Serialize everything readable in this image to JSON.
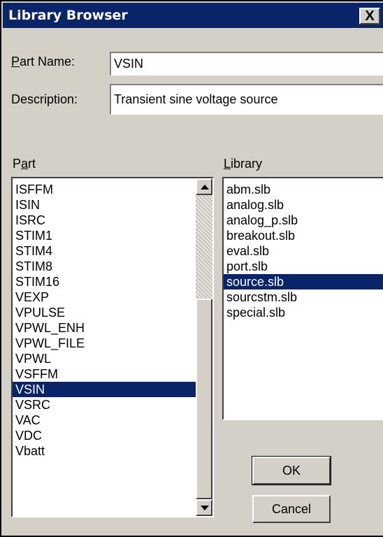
{
  "window": {
    "title": "Library Browser",
    "close_glyph": "X"
  },
  "part_name": {
    "label_accel": "P",
    "label_rest": "art Name:",
    "value": "VSIN"
  },
  "description": {
    "label": "Description:",
    "value": "Transient sine voltage source"
  },
  "part_list": {
    "label_pre": "P",
    "label_accel": "a",
    "label_post": "rt",
    "items": [
      "ISFFM",
      "ISIN",
      "ISRC",
      "STIM1",
      "STIM4",
      "STIM8",
      "STIM16",
      "VEXP",
      "VPULSE",
      "VPWL_ENH",
      "VPWL_FILE",
      "VPWL",
      "VSFFM",
      "VSIN",
      "VSRC",
      "VAC",
      "VDC",
      "Vbatt"
    ],
    "selected": "VSIN"
  },
  "library_list": {
    "label_accel": "L",
    "label_rest": "ibrary",
    "items": [
      "abm.slb",
      "analog.slb",
      "analog_p.slb",
      "breakout.slb",
      "eval.slb",
      "port.slb",
      "source.slb",
      "sourcstm.slb",
      "special.slb"
    ],
    "selected": "source.slb"
  },
  "buttons": {
    "ok": "OK",
    "cancel": "Cancel"
  }
}
